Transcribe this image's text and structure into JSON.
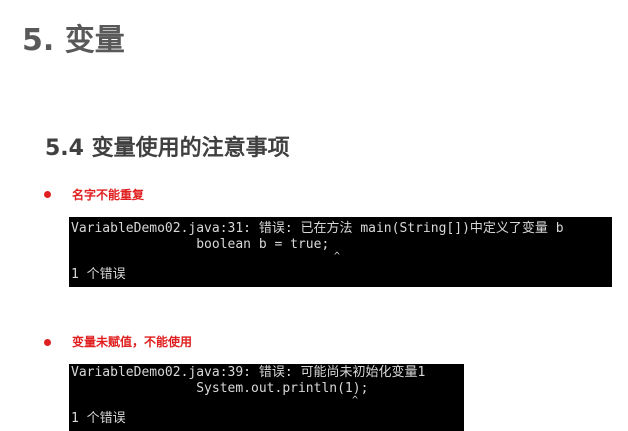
{
  "page": {
    "title": "5. 变量"
  },
  "section": {
    "title": "5.4 变量使用的注意事项"
  },
  "notes": [
    {
      "label": "名字不能重复",
      "console": {
        "lines": [
          "VariableDemo02.java:31: 错误: 已在方法 main(String[])中定义了变量 b",
          "                boolean b = true;",
          "1 个错误"
        ],
        "caret": "^"
      }
    },
    {
      "label": "变量未赋值，不能使用",
      "console": {
        "lines": [
          "VariableDemo02.java:39: 错误: 可能尚未初始化变量1",
          "                System.out.println(1);",
          "1 个错误"
        ],
        "caret": "^"
      }
    }
  ],
  "colors": {
    "accent": "#e02020",
    "heading": "#595959",
    "console_bg": "#000000",
    "console_text": "#d8d8d8"
  }
}
